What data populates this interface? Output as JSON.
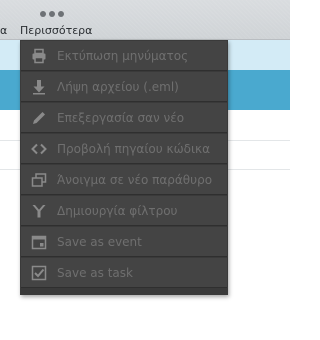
{
  "toolbar": {
    "edge_label": "α",
    "more": {
      "label": "Περισσότερα",
      "icon": "three-dots-icon"
    }
  },
  "colors": {
    "toolbar_bg": "#d3d7da",
    "row_light_blue": "#d3ebf6",
    "row_selected_blue": "#4aa9cf",
    "menu_bg": "#3a3a3a",
    "menu_item_bg": "#444444",
    "menu_text_disabled": "#6f6f6f",
    "menu_icon": "#8a8a8a"
  },
  "menu": {
    "items": [
      {
        "label": "Εκτύπωση μηνύματος",
        "icon": "printer-icon"
      },
      {
        "label": "Λήψη αρχείου (.eml)",
        "icon": "download-icon"
      },
      {
        "label": "Επεξεργασία σαν νέο",
        "icon": "pencil-icon"
      },
      {
        "label": "Προβολή πηγαίου κώδικα",
        "icon": "code-icon"
      },
      {
        "label": "Άνοιγμα σε νέο παράθυρο",
        "icon": "new-window-icon"
      },
      {
        "label": "Δημιουργία φίλτρου",
        "icon": "filter-icon"
      },
      {
        "label": "Save as event",
        "icon": "calendar-icon"
      },
      {
        "label": "Save as task",
        "icon": "checkbox-icon"
      }
    ]
  }
}
